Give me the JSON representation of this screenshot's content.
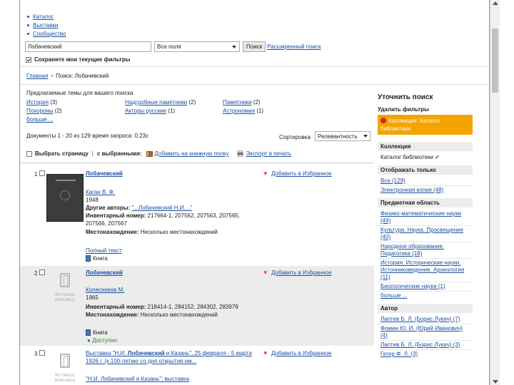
{
  "nav": {
    "items": [
      "Каталог",
      "Выставки",
      "Сообщество"
    ]
  },
  "search": {
    "query": "Лобачевский",
    "field": "Все поля",
    "button": "Поиск",
    "advanced": "Расширенный поиск",
    "keep_filters": "Сохраните мои текущие фильтры"
  },
  "breadcrumb": {
    "home": "Главная",
    "separator": ">",
    "current": "Поиск: Лобачевский"
  },
  "topics": {
    "title": "Предлагаемые темы для вашего поиска",
    "items": [
      {
        "label": "История",
        "count": "(3)"
      },
      {
        "label": "Надгробные памятники",
        "count": "(2)"
      },
      {
        "label": "Памятники",
        "count": "(2)"
      },
      {
        "label": "Похороны",
        "count": "(2)"
      },
      {
        "label": "Акторы русские",
        "count": "(1)"
      },
      {
        "label": "Астрономия",
        "count": "(1)"
      }
    ],
    "more": "больше ..."
  },
  "results_info": {
    "text": "Документы 1 - 20 из 129 время запроса: 0.23с",
    "sort_label": "Сортировка",
    "sort_value": "Релевантность"
  },
  "toolbar": {
    "select_page": "Выбрать страницу",
    "with_selected": "с выбранными:",
    "add_to_shelf": "Добавить на книжную полку",
    "print": "Экспорт в печать"
  },
  "results": [
    {
      "num": "1",
      "title": "Лобачевский",
      "fav": "Добавить в Избранное",
      "author": "Каган В. Ф.",
      "year": "1948",
      "other_label": "Другие авторы:",
      "other_value": "\"...Лобачевский Н.И....\"",
      "inv_label": "Инвентарный номер:",
      "inv_value": "217664-1, 207562, 207563, 207565,",
      "inv_value2": "207566, 207567",
      "loc_label": "Местонахождение:",
      "loc_value": "Несколько местонахождений",
      "fulltext": "Полный текст",
      "type": "Книга"
    },
    {
      "num": "2",
      "title": "Лобачевский",
      "fav": "Добавить в Избранное",
      "author": "Колесников М.",
      "year": "1965",
      "inv_label": "Инвентарный номер:",
      "inv_value": "218414-1, 284152, 284302, 283979",
      "loc_label": "Местонахождение:",
      "loc_value": "Несколько местонахождений",
      "type": "Книга",
      "available": "Доступно",
      "noimage": "NO IMAGE AVAILABLE"
    },
    {
      "num": "3",
      "title_prefix": "Выставка \"Н.И. ",
      "title_bold": "Лобачевский",
      "title_suffix": " и Казань\", 25 февраля - 5 марта",
      "title_line2": "1926 г. (к 100-летию со дня открытия им...",
      "title_line3": "\"Н.И. Лобачевский и Казань\": выставка",
      "fav": "Добавить в Избранное",
      "noimage": "NO IMAGE AVAILABLE"
    }
  ],
  "sidebar": {
    "title": "Уточнить поиск",
    "remove_filters": "Удалить фильтры",
    "active_filter": "Коллекция: Каталог библиотеки",
    "collection": {
      "head": "Коллекция",
      "item": "Каталог библиотеки"
    },
    "show_only": {
      "head": "Отображать только",
      "items": [
        "Все (129)",
        "Электронная копия (48)"
      ]
    },
    "subject": {
      "head": "Предметная область",
      "items": [
        "Физико-математические науки (49)",
        "Культура. Наука. Просвещение (40)",
        "Народное образование. Педагогика (18)",
        "История. Исторические науки. Источниковедение. Археология (11)",
        "Биологические науки (1)",
        "больше ..."
      ]
    },
    "author": {
      "head": "Автор",
      "items": [
        "Лаптев Б. Л. (Борис Лукич) (7)",
        "Фомин Ю. И. (Юрий Иванович) (4)",
        "Лаптев Б. Л. (Борис Лукич) (3)",
        "Гегер Ф. Л. (3)"
      ]
    }
  },
  "colors": {
    "link": "#1a4fa0",
    "filter_bg": "#f5a300",
    "alt_row": "#ececec",
    "available": "#2a8a2a"
  }
}
